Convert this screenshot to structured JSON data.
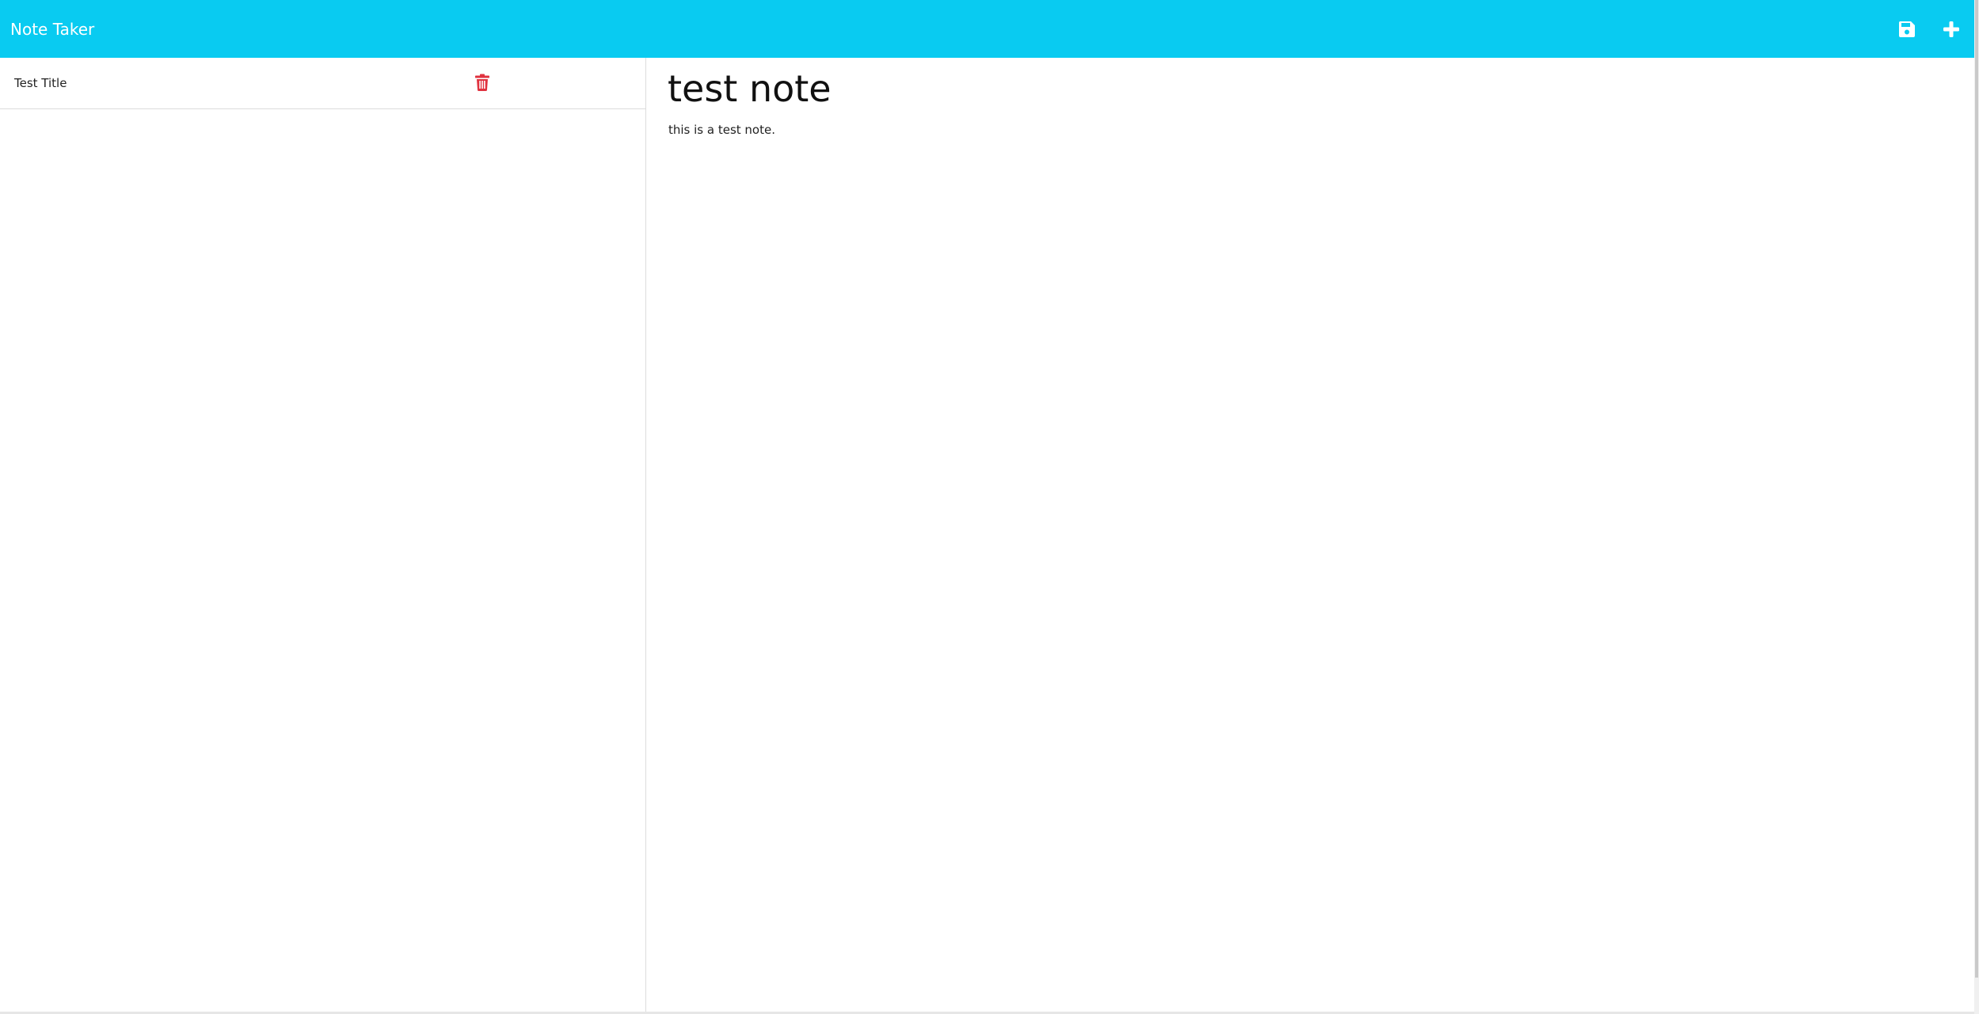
{
  "app": {
    "title": "Note Taker",
    "accent_color": "#09cbf1"
  },
  "toolbar": {
    "save_icon": "save-icon",
    "new_icon": "plus-icon"
  },
  "notes": [
    {
      "title": "Test Title",
      "delete_icon": "trash-icon",
      "delete_color": "#e0323f"
    }
  ],
  "active_note": {
    "title": "test note",
    "text": "this is a test note."
  }
}
